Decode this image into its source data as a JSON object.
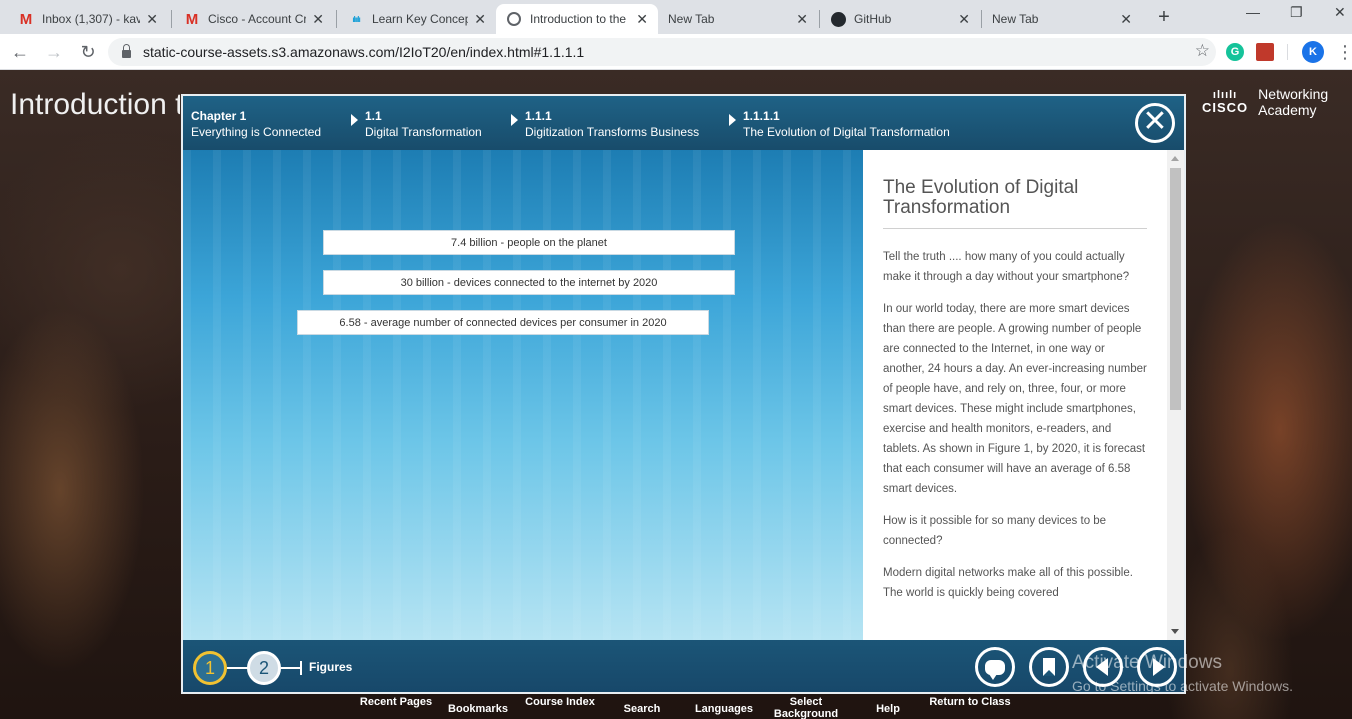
{
  "browser": {
    "tabs": [
      {
        "title": "Inbox (1,307) - kav",
        "icon": "gmail-icon"
      },
      {
        "title": "Cisco - Account Cr",
        "icon": "gmail-icon"
      },
      {
        "title": "Learn Key Concept",
        "icon": "cisco-icon"
      },
      {
        "title": "Introduction to the",
        "icon": "globe-icon",
        "active": true
      },
      {
        "title": "New Tab",
        "icon": ""
      },
      {
        "title": "GitHub",
        "icon": "github-icon"
      },
      {
        "title": "New Tab",
        "icon": ""
      }
    ],
    "tab_close_glyph": "✕",
    "new_tab_glyph": "+",
    "url": "static-course-assets.s3.amazonaws.com/I2IoT20/en/index.html#1.1.1.1",
    "profile_initial": "K",
    "grammarly_initial": "G"
  },
  "page": {
    "background_title": "Introduction t",
    "logo": {
      "brand": "CISCO",
      "line1": "Networking",
      "line2": "Academy"
    }
  },
  "modal": {
    "breadcrumbs": [
      {
        "num": "Chapter 1",
        "label": "Everything is Connected"
      },
      {
        "num": "1.1",
        "label": "Digital Transformation"
      },
      {
        "num": "1.1.1",
        "label": "Digitization Transforms Business"
      },
      {
        "num": "1.1.1.1",
        "label": "The Evolution of Digital Transformation"
      }
    ],
    "close_glyph": "✕",
    "figure": {
      "stats": [
        "7.4 billion - people on the planet",
        "30 billion - devices connected to the internet by 2020",
        "6.58 - average number of connected devices per consumer in 2020"
      ]
    },
    "text": {
      "title": "The Evolution of Digital Transformation",
      "paragraphs": [
        "Tell the truth .... how many of you could actually make it through a day without your smartphone?",
        "In our world today, there are more smart devices than there are people. A growing number of people are connected to the Internet, in one way or another, 24 hours a day. An ever-increasing number of people have, and rely on, three, four, or more smart devices. These might include smartphones, exercise and health monitors, e-readers, and tablets. As shown in Figure 1, by 2020, it is forecast that each consumer will have an average of 6.58 smart devices.",
        "How is it possible for so many devices to be connected?",
        "Modern digital networks make all of this possible. The world is quickly being covered"
      ]
    },
    "footer": {
      "figure_steps": [
        "1",
        "2"
      ],
      "figures_label": "Figures"
    }
  },
  "watermark": {
    "line1": "Activate Windows",
    "line2": "Go to Settings to activate Windows."
  },
  "bottom_nav": [
    "Recent Pages",
    "Bookmarks",
    "Course Index",
    "Search",
    "Languages",
    "Select Background",
    "Help",
    "Return to Class"
  ]
}
